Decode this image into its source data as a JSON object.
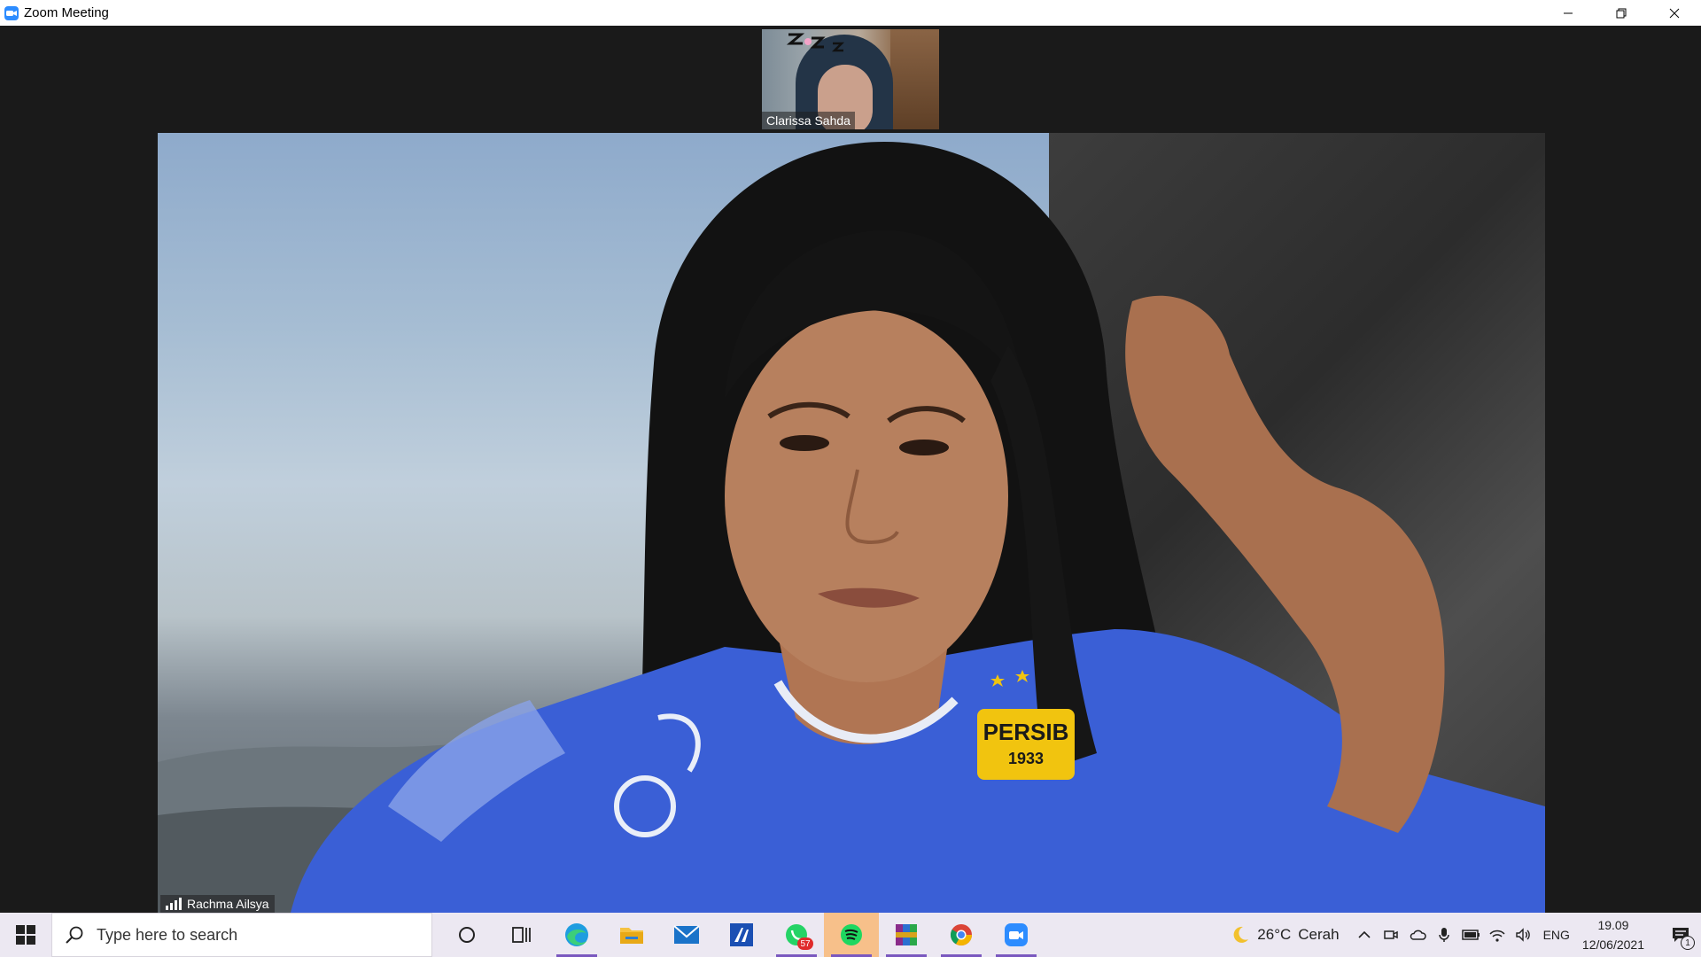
{
  "window": {
    "title": "Zoom Meeting",
    "controls": [
      "minimize",
      "restore",
      "close"
    ]
  },
  "meeting": {
    "thumbnail": {
      "participant_name": "Clarissa Sahda"
    },
    "main_video": {
      "participant_name": "Rachma Ailsya",
      "jersey_text": "PERSIB",
      "jersey_year": "1933"
    }
  },
  "taskbar": {
    "search_placeholder": "Type here to search",
    "pinned_apps": [
      {
        "name": "cortana",
        "icon": "circle-icon"
      },
      {
        "name": "task-view",
        "icon": "task-view-icon"
      },
      {
        "name": "edge",
        "icon": "edge-icon",
        "active": true
      },
      {
        "name": "file-explorer",
        "icon": "folder-icon"
      },
      {
        "name": "mail",
        "icon": "mail-icon"
      },
      {
        "name": "app",
        "icon": "app-icon"
      },
      {
        "name": "whatsapp",
        "icon": "whatsapp-icon",
        "badge": "57",
        "active": true
      },
      {
        "name": "spotify",
        "icon": "spotify-icon",
        "highlight": true
      },
      {
        "name": "winrar",
        "icon": "winrar-icon",
        "active": true
      },
      {
        "name": "chrome",
        "icon": "chrome-icon",
        "active": true
      },
      {
        "name": "zoom",
        "icon": "zoom-icon",
        "active": true
      }
    ],
    "weather": {
      "temperature": "26°C",
      "condition": "Cerah"
    },
    "language": "ENG",
    "clock": {
      "time": "19.09",
      "date": "12/06/2021"
    },
    "notifications_count": "1"
  },
  "colors": {
    "zoom_blue": "#2d8cff",
    "taskbar_bg": "#ece8f2",
    "active_indicator": "#7a58bf",
    "highlight": "#f7c08a"
  }
}
